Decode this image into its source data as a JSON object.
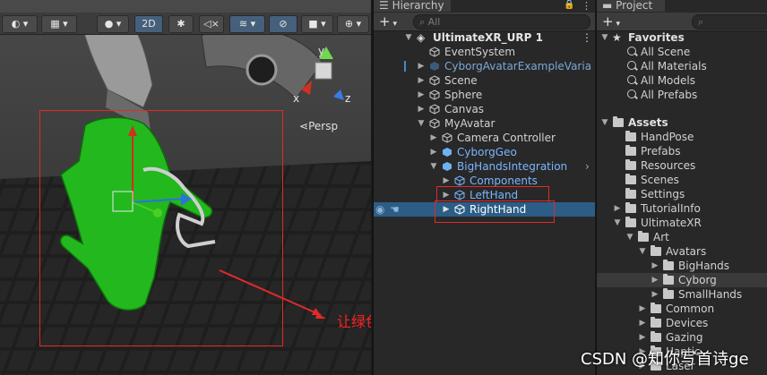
{
  "scene": {
    "mode_2d": "2D",
    "camera_label": "Persp",
    "gizmo_axes": {
      "x": "x",
      "y": "y",
      "z": "z"
    },
    "annotation": "让绿色手部与模型大致重合，另一侧也是",
    "watermark": "CSDN @知你写首诗ge"
  },
  "hierarchy": {
    "tab_title": "Hierarchy",
    "add_label": "+",
    "search_placeholder": "All",
    "root": "UltimateXR_URP 1",
    "rows": [
      {
        "label": "EventSystem"
      },
      {
        "label": "CyborgAvatarExampleVaria"
      },
      {
        "label": "Scene"
      },
      {
        "label": "Sphere"
      },
      {
        "label": "Canvas"
      },
      {
        "label": "MyAvatar"
      },
      {
        "label": "Camera Controller"
      },
      {
        "label": "CyborgGeo"
      },
      {
        "label": "BigHandsIntegration"
      },
      {
        "label": "Components"
      },
      {
        "label": "LeftHand"
      },
      {
        "label": "RightHand"
      }
    ]
  },
  "project": {
    "tab_title": "Project",
    "add_label": "+",
    "favorites_label": "Favorites",
    "favorites": [
      "All Scene",
      "All Materials",
      "All Models",
      "All Prefabs"
    ],
    "assets_label": "Assets",
    "folders": [
      {
        "label": "HandPose"
      },
      {
        "label": "Prefabs"
      },
      {
        "label": "Resources"
      },
      {
        "label": "Scenes"
      },
      {
        "label": "Settings"
      },
      {
        "label": "TutorialInfo"
      },
      {
        "label": "UltimateXR"
      },
      {
        "label": "Art"
      },
      {
        "label": "Avatars"
      },
      {
        "label": "BigHands"
      },
      {
        "label": "Cyborg"
      },
      {
        "label": "SmallHands"
      },
      {
        "label": "Common"
      },
      {
        "label": "Devices"
      },
      {
        "label": "Gazing"
      },
      {
        "label": "Haptic"
      },
      {
        "label": "Laser"
      }
    ]
  },
  "colors": {
    "selection": "#2c5d87",
    "annotation": "#e02a2a",
    "hand_green": "#22b81e"
  }
}
